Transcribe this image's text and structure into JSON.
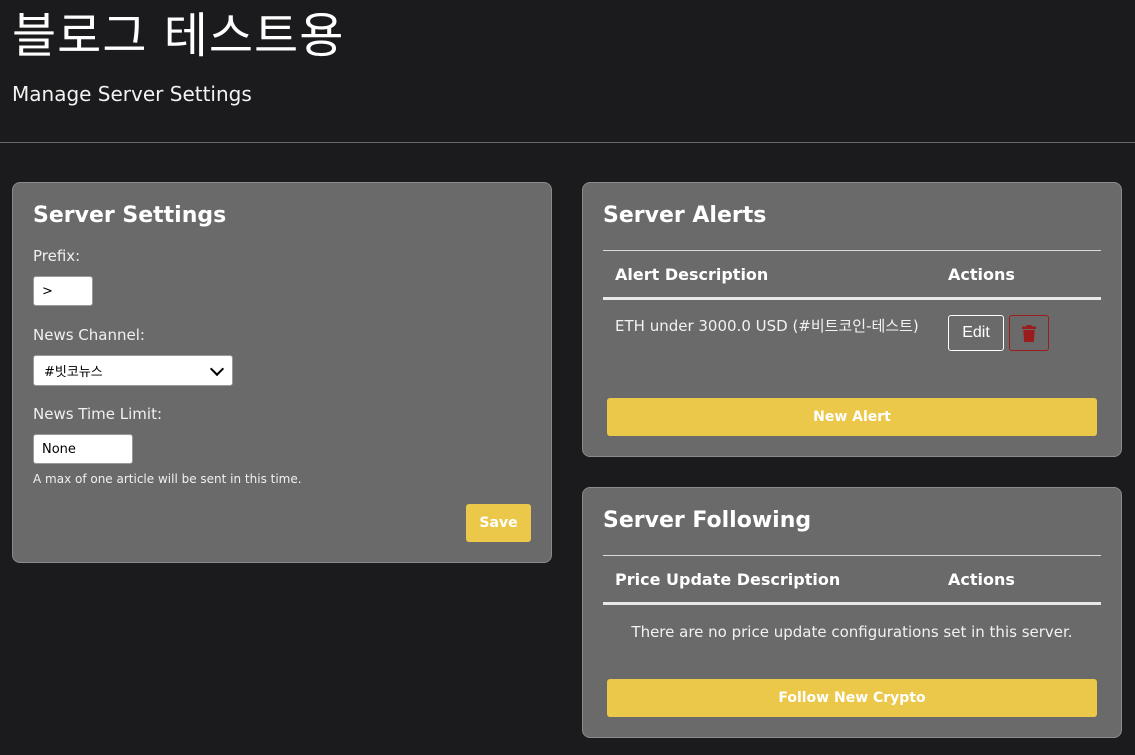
{
  "header": {
    "title": "블로그 테스트용",
    "subtitle": "Manage Server Settings"
  },
  "settings": {
    "title": "Server Settings",
    "prefix_label": "Prefix:",
    "prefix_value": ">",
    "news_channel_label": "News Channel:",
    "news_channel_value": "#빗코뉴스",
    "time_limit_label": "News Time Limit:",
    "time_limit_value": "None",
    "help_text": "A max of one article will be sent in this time.",
    "save_label": "Save"
  },
  "alerts": {
    "title": "Server Alerts",
    "columns": [
      "Alert Description",
      "Actions"
    ],
    "rows": [
      {
        "description": "ETH under 3000.0 USD (#비트코인-테스트)",
        "edit_label": "Edit"
      }
    ],
    "new_label": "New Alert"
  },
  "following": {
    "title": "Server Following",
    "columns": [
      "Price Update Description",
      "Actions"
    ],
    "empty_text": "There are no price update configurations set in this server.",
    "follow_label": "Follow New Crypto"
  },
  "colors": {
    "background": "#1b1b1d",
    "card": "#6a6a6a",
    "accent": "#ecc84a",
    "danger": "#9b1c1c"
  },
  "icons": {
    "delete": "trash-icon",
    "dropdown": "chevron-down-icon"
  }
}
